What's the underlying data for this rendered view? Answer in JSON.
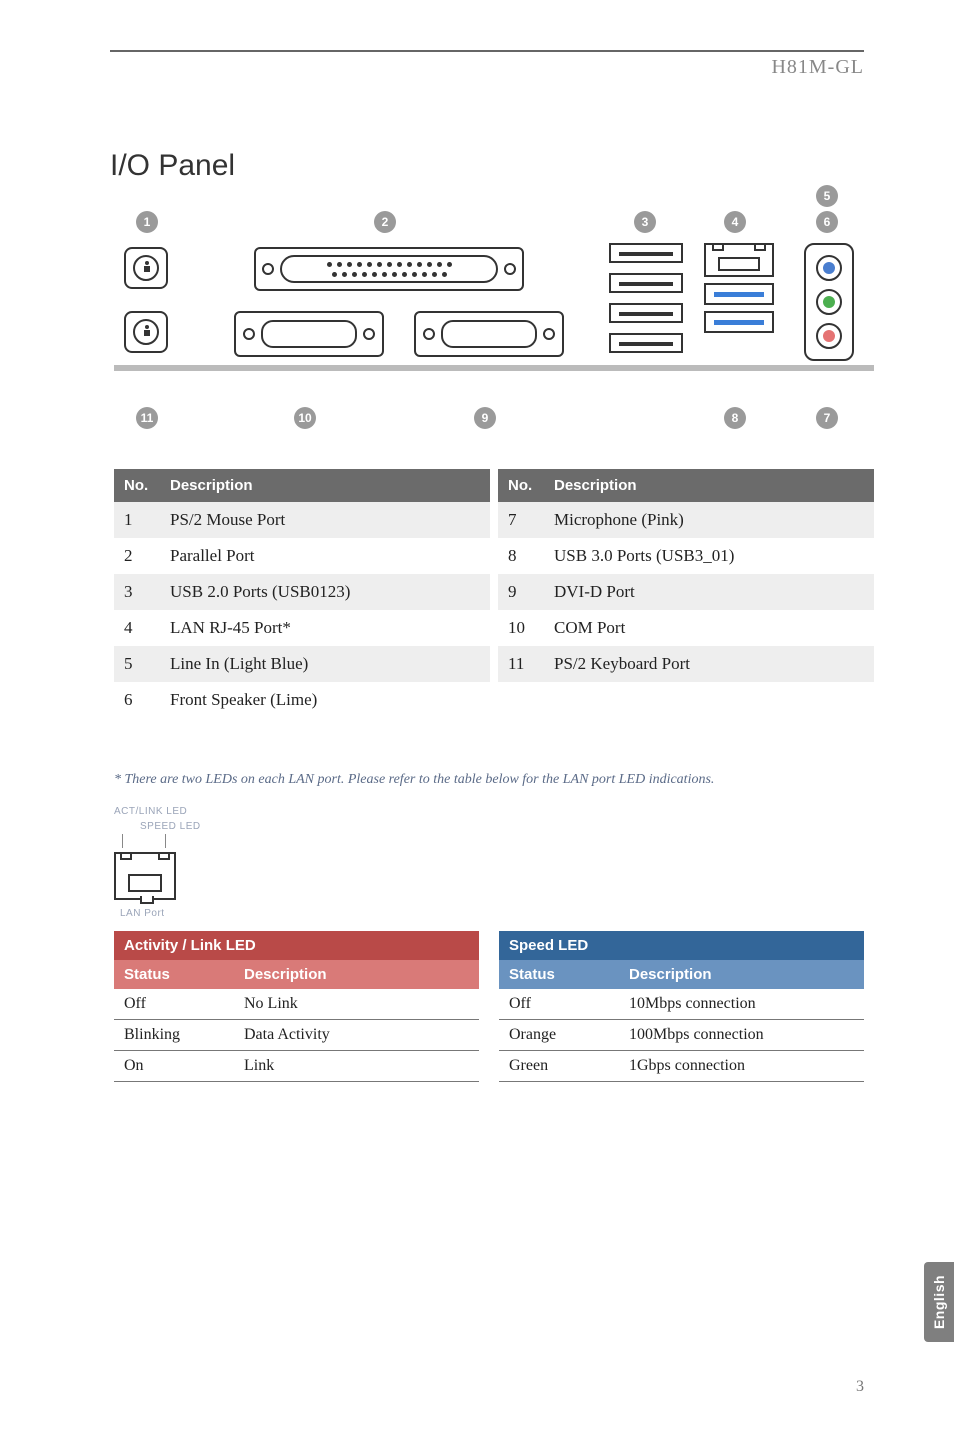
{
  "header": {
    "model": "H81M-GL"
  },
  "title": "I/O Panel",
  "callouts_top": [
    "1",
    "2",
    "3",
    "4",
    "5",
    "6"
  ],
  "callouts_bottom": [
    "11",
    "10",
    "9",
    "8",
    "7"
  ],
  "jack_colors": [
    "#4a7ecf",
    "#4caf50",
    "#e57373"
  ],
  "desc_table": {
    "head_no": "No.",
    "head_desc": "Description",
    "rows": [
      {
        "l_no": "1",
        "l_desc": "PS/2 Mouse Port",
        "r_no": "7",
        "r_desc": "Microphone (Pink)",
        "alt": true
      },
      {
        "l_no": "2",
        "l_desc": "Parallel Port",
        "r_no": "8",
        "r_desc": "USB 3.0 Ports (USB3_01)",
        "alt": false
      },
      {
        "l_no": "3",
        "l_desc": "USB 2.0 Ports (USB0123)",
        "r_no": "9",
        "r_desc": "DVI-D Port",
        "alt": true
      },
      {
        "l_no": "4",
        "l_desc": "LAN RJ-45 Port*",
        "r_no": "10",
        "r_desc": "COM Port",
        "alt": false
      },
      {
        "l_no": "5",
        "l_desc": "Line In (Light Blue)",
        "r_no": "11",
        "r_desc": "PS/2 Keyboard Port",
        "alt": true
      },
      {
        "l_no": "6",
        "l_desc": "Front Speaker (Lime)",
        "r_no": "",
        "r_desc": "",
        "alt": false
      }
    ]
  },
  "footnote": "* There are two LEDs on each LAN port. Please refer to the table below for the LAN port LED indications.",
  "lan_fig": {
    "act_label": "ACT/LINK LED",
    "speed_label": "SPEED LED",
    "port_label": "LAN Port"
  },
  "led_left": {
    "title": "Activity / Link LED",
    "col1": "Status",
    "col2": "Description",
    "rows": [
      {
        "a": "Off",
        "b": "No Link"
      },
      {
        "a": "Blinking",
        "b": "Data Activity"
      },
      {
        "a": "On",
        "b": "Link"
      }
    ]
  },
  "led_right": {
    "title": "Speed LED",
    "col1": "Status",
    "col2": "Description",
    "rows": [
      {
        "a": "Off",
        "b": "10Mbps connection"
      },
      {
        "a": "Orange",
        "b": "100Mbps connection"
      },
      {
        "a": "Green",
        "b": "1Gbps connection"
      }
    ]
  },
  "side_tab": "English",
  "page_number": "3"
}
